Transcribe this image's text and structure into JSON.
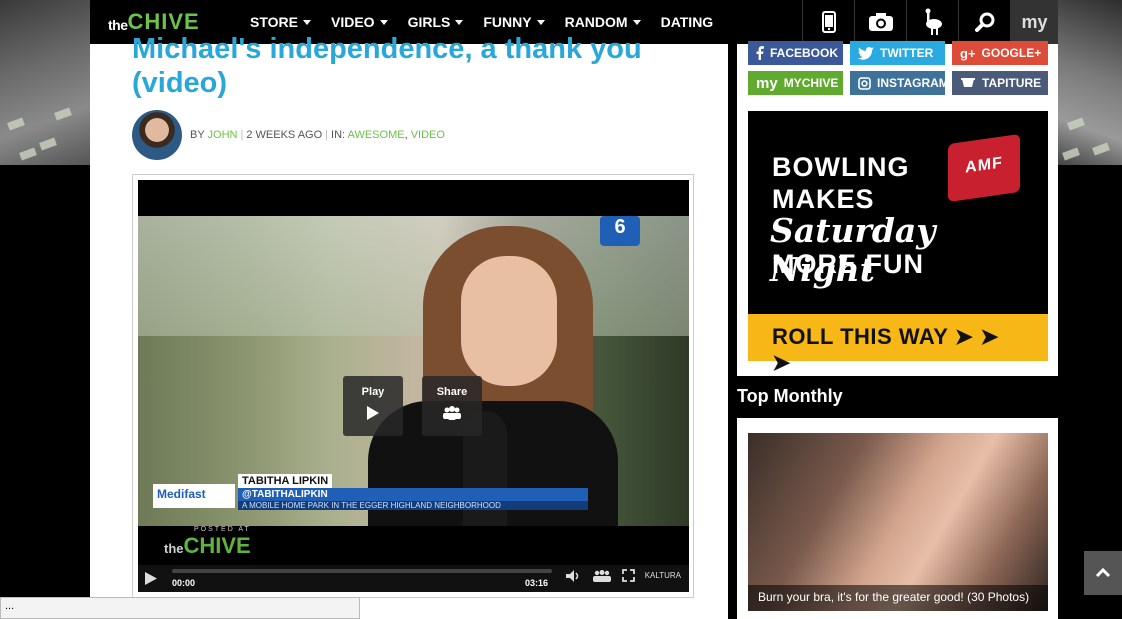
{
  "nav": {
    "logo_the": "the",
    "logo_chive": "CHIVE",
    "items": [
      {
        "label": "STORE",
        "caret": true
      },
      {
        "label": "VIDEO",
        "caret": true
      },
      {
        "label": "GIRLS",
        "caret": true
      },
      {
        "label": "FUNNY",
        "caret": true
      },
      {
        "label": "RANDOM",
        "caret": true
      },
      {
        "label": "DATING",
        "caret": false
      }
    ],
    "icons": [
      "phone-icon",
      "camera-icon",
      "ostrich-icon",
      "search-icon"
    ],
    "my_label": "my"
  },
  "article": {
    "title": "Michael's independence, a thank you (video)",
    "by_prefix": "BY ",
    "author": "JOHN",
    "time": "2 WEEKS AGO",
    "in_prefix": "IN: ",
    "cat1": "AWESOME",
    "cat2": "VIDEO"
  },
  "video": {
    "play_label": "Play",
    "share_label": "Share",
    "lower_third_name": "TABITHA LIPKIN",
    "lower_third_handle": "@TABITHALIPKIN",
    "lower_third_sub": "A MOBILE HOME PARK IN THE EGGER HIGHLAND NEIGHBORHOOD",
    "sponsor": "Medifast",
    "channel": "6",
    "posted_at": "POSTED AT",
    "posted_the": "the",
    "posted_chive": "CHIVE",
    "time_current": "00:00",
    "time_total": "03:16",
    "provider": "KALTURA"
  },
  "status_bar": "...",
  "sidebar": {
    "social": [
      {
        "label": "FACEBOOK",
        "color": "#3b5998",
        "icon": "facebook-icon"
      },
      {
        "label": "TWITTER",
        "color": "#2ba9e1",
        "icon": "twitter-icon"
      },
      {
        "label": "GOOGLE+",
        "color": "#dd4b39",
        "icon": "google-plus-icon"
      },
      {
        "label": "MYCHIVE",
        "color": "#5faa2f",
        "icon": "mychive-icon"
      },
      {
        "label": "INSTAGRAM",
        "color": "#3f729b",
        "icon": "instagram-icon"
      },
      {
        "label": "TAPITURE",
        "color": "#4a5a78",
        "icon": "tapiture-icon"
      }
    ],
    "ad": {
      "line1": "BOWLING",
      "line2": "MAKES",
      "script": "Saturday Night",
      "line3": "MORE FUN",
      "brand": "AMF",
      "cta": "ROLL THIS WAY"
    },
    "top_monthly_title": "Top Monthly",
    "top_monthly_caption": "Burn your bra, it's for the greater good! (30 Photos)"
  }
}
